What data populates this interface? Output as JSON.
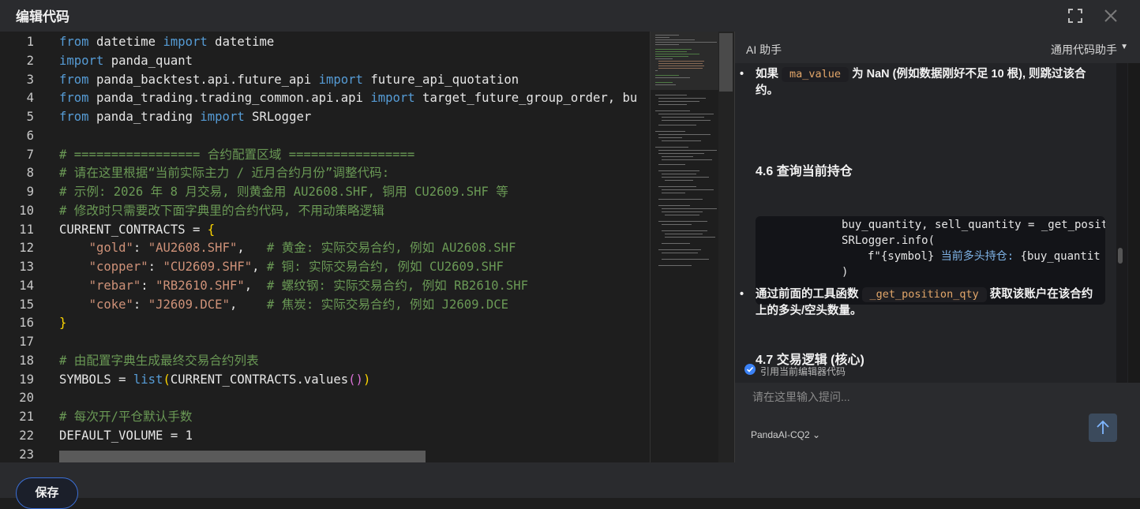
{
  "window": {
    "title": "编辑代码"
  },
  "editor": {
    "lines": [
      {
        "n": "1"
      },
      {
        "n": "2"
      },
      {
        "n": "3"
      },
      {
        "n": "4"
      },
      {
        "n": "5"
      },
      {
        "n": "6"
      },
      {
        "n": "7"
      },
      {
        "n": "8"
      },
      {
        "n": "9"
      },
      {
        "n": "10"
      },
      {
        "n": "11"
      },
      {
        "n": "12"
      },
      {
        "n": "13"
      },
      {
        "n": "14"
      },
      {
        "n": "15"
      },
      {
        "n": "16"
      },
      {
        "n": "17"
      },
      {
        "n": "18"
      },
      {
        "n": "19"
      },
      {
        "n": "20"
      },
      {
        "n": "21"
      },
      {
        "n": "22"
      },
      {
        "n": "23"
      }
    ],
    "code": {
      "l1": {
        "a": "from",
        "b": " datetime ",
        "c": "import",
        "d": " datetime"
      },
      "l2": {
        "a": "import",
        "b": " panda_quant"
      },
      "l3": {
        "a": "from",
        "b": " panda_backtest.api.future_api ",
        "c": "import",
        "d": " future_api_quotation"
      },
      "l4": {
        "a": "from",
        "b": " panda_trading.trading_common.api.api ",
        "c": "import",
        "d": " target_future_group_order, bu"
      },
      "l5": {
        "a": "from",
        "b": " panda_trading ",
        "c": "import",
        "d": " SRLogger"
      },
      "l7": "# ================= 合约配置区域 =================",
      "l8": "# 请在这里根据“当前实际主力 / 近月合约月份”调整代码:",
      "l9": "# 示例: 2026 年 8 月交易, 则黄金用 AU2608.SHF, 铜用 CU2609.SHF 等",
      "l10": "# 修改时只需要改下面字典里的合约代码, 不用动策略逻辑",
      "l11": {
        "a": "CURRENT_CONTRACTS = ",
        "b": "{"
      },
      "l12": {
        "k": "\"gold\"",
        "s": ": ",
        "v": "\"AU2608.SHF\"",
        "p": ",   ",
        "c": "# 黄金: 实际交易合约, 例如 AU2608.SHF"
      },
      "l13": {
        "k": "\"copper\"",
        "s": ": ",
        "v": "\"CU2609.SHF\"",
        "p": ", ",
        "c": "# 铜: 实际交易合约, 例如 CU2609.SHF"
      },
      "l14": {
        "k": "\"rebar\"",
        "s": ": ",
        "v": "\"RB2610.SHF\"",
        "p": ",  ",
        "c": "# 螺纹钢: 实际交易合约, 例如 RB2610.SHF"
      },
      "l15": {
        "k": "\"coke\"",
        "s": ": ",
        "v": "\"J2609.DCE\"",
        "p": ",    ",
        "c": "# 焦炭: 实际交易合约, 例如 J2609.DCE"
      },
      "l16": "}",
      "l18": "# 由配置字典生成最终交易合约列表",
      "l19": {
        "a": "SYMBOLS = ",
        "b": "list",
        "c": "(",
        "d": "CURRENT_CONTRACTS.values",
        "e": "()",
        "f": ")"
      },
      "l21": "# 每次开/平仓默认手数",
      "l22": "DEFAULT_VOLUME = 1"
    }
  },
  "assistant": {
    "title": "AI 助手",
    "mode": "通用代码助手",
    "b1_pre": "如果 ",
    "b1_code": "ma_value",
    "b1_post": " 为 NaN (例如数据刚好不足 10 根), 则跳过该合约。",
    "h46": "4.6 查询当前持仓",
    "cb1": "buy_quantity, sell_quantity = _get_positi",
    "cb2": "SRLogger.info(",
    "cb3a": "f\"{symbol} ",
    "cb3b": "当前多头持仓: ",
    "cb3c": "{buy_quantit",
    "cb4": ")",
    "b2_pre": "通过前面的工具函数 ",
    "b2_code": "_get_position_qty",
    "b2_post": " 获取该账户在该合约上的多头/空头数量。",
    "h47": "4.7 交易逻辑 (核心)",
    "ref_label": "引用当前编辑器代码",
    "placeholder": "请在这里输入提问...",
    "model": "PandaAI-CQ2"
  },
  "footer": {
    "save_label": "保存"
  }
}
